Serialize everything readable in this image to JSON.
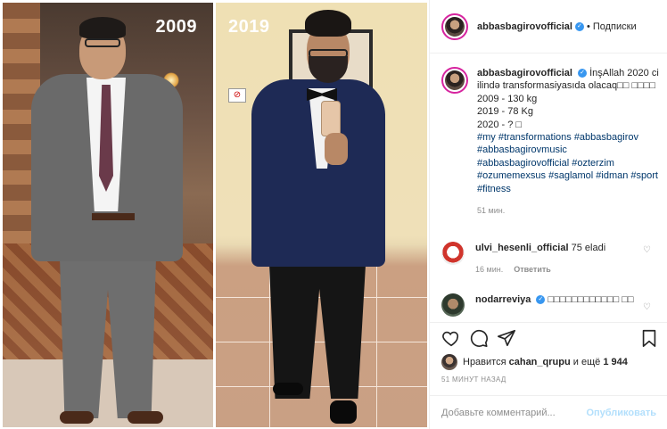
{
  "photo": {
    "year_left": "2009",
    "year_right": "2019"
  },
  "header": {
    "username": "abbasbagirovofficial",
    "separator": "•",
    "follow_label": "Подписки"
  },
  "caption": {
    "username": "abbasbagirovofficial",
    "text_line1": "İnşAllah 2020 ci ilində transformasiyasıda olacaq□□ □□□□",
    "line2": "2009 - 130 kg",
    "line3": "2019 - 78 Kg",
    "line4": "2020 - ? □",
    "hashtags": "#my #transformations #abbasbagirov #abbasbagirovmusic #abbasbagirovofficial #ozterzim #ozumemexsus #saglamol #idman #sport #fitness",
    "time": "51 мин."
  },
  "comments": [
    {
      "username": "ulvi_hesenli_official",
      "text": "75 eladi",
      "time": "16 мин.",
      "reply_label": "Ответить"
    },
    {
      "username": "nodarreviya",
      "text": "□□□□□□□□□□□□ □□"
    }
  ],
  "likes": {
    "prefix": "Нравится",
    "user": "cahan_qrupu",
    "middle": "и ещё",
    "count": "1 944"
  },
  "posted_ago": "51 МИНУТ НАЗАД",
  "add_comment": {
    "placeholder": "Добавьте комментарий...",
    "publish_label": "Опубликовать"
  },
  "colors": {
    "verified": "#3897f0",
    "link": "#00376b",
    "muted": "#8e8e8e",
    "publish_disabled": "#b2dffc"
  }
}
